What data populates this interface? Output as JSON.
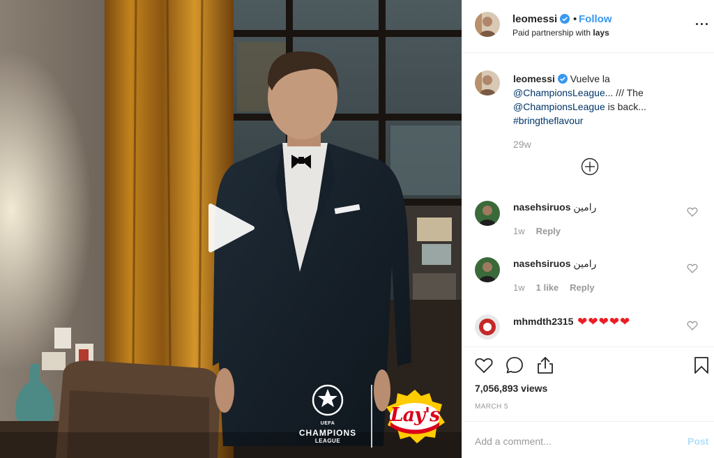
{
  "header": {
    "username": "leomessi",
    "separator": "•",
    "follow_label": "Follow",
    "paid_prefix": "Paid partnership with ",
    "partner": "lays"
  },
  "caption": {
    "username": "leomessi",
    "text_1": " Vuelve la ",
    "mention_1": "@ChampionsLeague",
    "text_2": "... /// The ",
    "mention_2": "@ChampionsLeague",
    "text_3": " is back... ",
    "hashtag": "#bringtheflavour",
    "time": "29w"
  },
  "comments": [
    {
      "username": "nasehsiruos",
      "text": " رامين",
      "time": "1w",
      "likes": "",
      "reply_label": "Reply"
    },
    {
      "username": "nasehsiruos",
      "text": " رامين",
      "time": "1w",
      "likes": "1 like",
      "reply_label": "Reply"
    },
    {
      "username": "mhmdth2315",
      "text": " ❤❤❤❤❤",
      "time": "",
      "likes": "",
      "reply_label": ""
    }
  ],
  "stats": {
    "views": "7,056,893 views",
    "date": "MARCH 5"
  },
  "add_comment": {
    "placeholder": "Add a comment...",
    "post_label": "Post"
  },
  "media": {
    "ucl_uefa": "UEFA",
    "ucl_champions": "CHAMPIONS",
    "ucl_league": "LEAGUE",
    "brand": "Lay's"
  },
  "colors": {
    "link": "#3897f0",
    "mention": "#003569",
    "muted": "#999999",
    "verified": "#3897f0",
    "hearts": "#ed1c24"
  }
}
